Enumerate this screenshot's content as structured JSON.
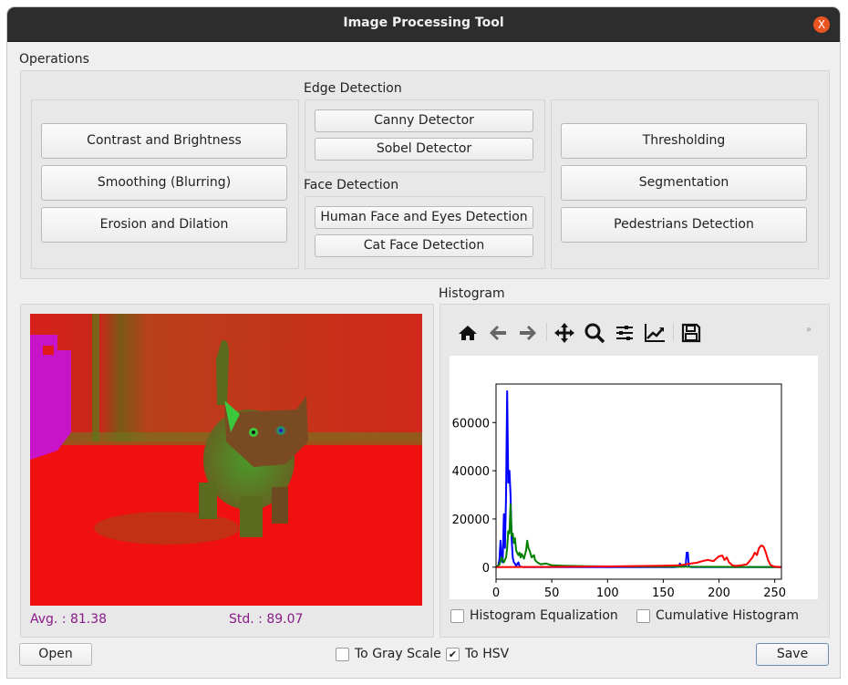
{
  "window": {
    "title": "Image Processing Tool",
    "close_label": "X"
  },
  "operations": {
    "label": "Operations",
    "left_buttons": [
      "Contrast and Brightness",
      "Smoothing (Blurring)",
      "Erosion and Dilation"
    ],
    "edge_detection": {
      "label": "Edge Detection",
      "buttons": [
        "Canny Detector",
        "Sobel Detector"
      ]
    },
    "face_detection": {
      "label": "Face Detection",
      "buttons": [
        "Human Face and Eyes Detection",
        "Cat Face Detection"
      ]
    },
    "right_buttons": [
      "Thresholding",
      "Segmentation",
      "Pedestrians Detection"
    ]
  },
  "image_panel": {
    "avg_label": "Avg. : 81.38",
    "std_label": "Std. : 89.07",
    "colors": {
      "background": "#f01010",
      "accent_green": "#3cc83c",
      "magenta": "#c814c8"
    }
  },
  "histogram": {
    "label": "Histogram",
    "toolbar": [
      {
        "icon": "home-icon",
        "glyph": "home"
      },
      {
        "icon": "back-arrow-icon",
        "glyph": "back"
      },
      {
        "icon": "forward-arrow-icon",
        "glyph": "forward"
      },
      {
        "icon": "pan-icon",
        "glyph": "pan"
      },
      {
        "icon": "zoom-icon",
        "glyph": "zoom"
      },
      {
        "icon": "subplots-icon",
        "glyph": "subplots"
      },
      {
        "icon": "edit-axis-icon",
        "glyph": "axes"
      },
      {
        "icon": "save-icon",
        "glyph": "save"
      }
    ],
    "overflow_label": "»",
    "equalization_label": "Histogram Equalization",
    "equalization_checked": false,
    "cumulative_label": "Cumulative Histogram",
    "cumulative_checked": false
  },
  "bottom": {
    "open_label": "Open",
    "gray_label": "To Gray Scale",
    "gray_checked": false,
    "hsv_label": "To HSV",
    "hsv_checked": true,
    "save_label": "Save"
  },
  "chart_data": {
    "type": "line",
    "title": "",
    "xlabel": "",
    "ylabel": "",
    "xlim": [
      0,
      256
    ],
    "ylim": [
      -5000,
      76000
    ],
    "xticks": [
      0,
      50,
      100,
      150,
      200,
      250
    ],
    "yticks": [
      0,
      20000,
      40000,
      60000
    ],
    "ytick_labels": [
      "0",
      "20000",
      "40000",
      "60000"
    ],
    "grid": false,
    "series": [
      {
        "name": "blue",
        "color": "#0000ff",
        "x": [
          0,
          2,
          3,
          4,
          5,
          6,
          7,
          8,
          9,
          10,
          11,
          12,
          13,
          14,
          15,
          16,
          17,
          18,
          20,
          21,
          22,
          25,
          40,
          100,
          160,
          164,
          165,
          166,
          170,
          171,
          172,
          173,
          174,
          176,
          200,
          256
        ],
        "y": [
          0,
          500,
          3000,
          11000,
          4000,
          2000,
          22000,
          8000,
          30000,
          73000,
          35000,
          40000,
          30000,
          12000,
          4000,
          2000,
          1500,
          500,
          2000,
          500,
          200,
          0,
          0,
          0,
          0,
          200,
          1500,
          200,
          300,
          6000,
          6000,
          300,
          100,
          0,
          0,
          0
        ]
      },
      {
        "name": "green",
        "color": "#008000",
        "x": [
          0,
          3,
          5,
          7,
          9,
          10,
          11,
          12,
          13,
          14,
          15,
          16,
          17,
          18,
          19,
          20,
          21,
          22,
          23,
          25,
          27,
          28,
          29,
          30,
          32,
          34,
          35,
          37,
          40,
          45,
          50,
          60,
          80,
          100,
          150,
          256
        ],
        "y": [
          0,
          1000,
          4000,
          2000,
          4000,
          8000,
          15000,
          14000,
          26000,
          13000,
          14000,
          10000,
          12000,
          7000,
          6000,
          5000,
          6000,
          4000,
          5500,
          3500,
          7000,
          11000,
          8000,
          7000,
          4000,
          5000,
          3000,
          2000,
          1200,
          1500,
          800,
          600,
          400,
          300,
          200,
          0
        ]
      },
      {
        "name": "red",
        "color": "#ff0000",
        "x": [
          0,
          50,
          100,
          150,
          165,
          175,
          180,
          185,
          190,
          195,
          200,
          203,
          205,
          207,
          209,
          212,
          215,
          220,
          225,
          230,
          232,
          234,
          236,
          238,
          240,
          242,
          244,
          246,
          248,
          250,
          253,
          256
        ],
        "y": [
          0,
          100,
          300,
          600,
          800,
          1500,
          1800,
          2500,
          3000,
          2500,
          4500,
          4800,
          3000,
          4000,
          2000,
          800,
          500,
          800,
          1200,
          4000,
          6000,
          5000,
          8000,
          9000,
          8500,
          6000,
          3000,
          1000,
          500,
          200,
          100,
          0
        ]
      }
    ]
  }
}
